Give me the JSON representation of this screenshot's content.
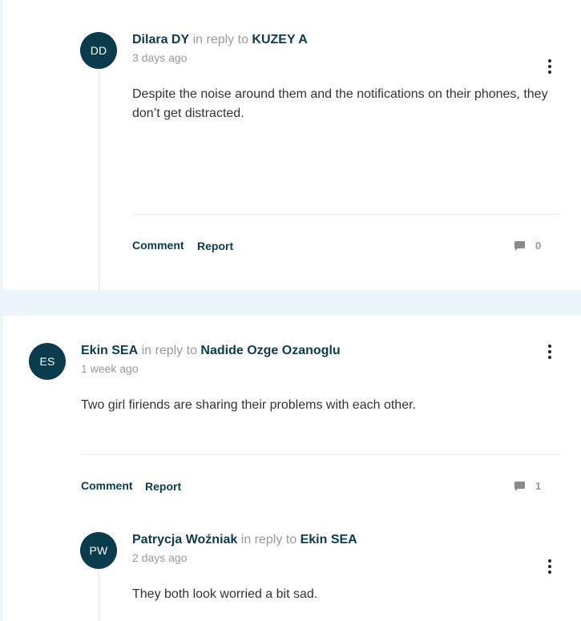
{
  "comments": [
    {
      "initials": "DD",
      "author": "Dilara DY",
      "reply_prefix": "in reply to",
      "reply_to": "KUZEY A",
      "time": "3 days ago",
      "text": "Despite the noise around them and the notifications on their phones, they don’t get distracted.",
      "comment_label": "Comment",
      "report_label": "Report",
      "reply_count": "0"
    },
    {
      "initials": "ES",
      "author": "Ekin SEA",
      "reply_prefix": "in reply to",
      "reply_to": "Nadide Ozge Ozanoglu",
      "time": "1 week ago",
      "text": "Two girl firiends are sharing their problems with each other.",
      "comment_label": "Comment",
      "report_label": "Report",
      "reply_count": "1"
    },
    {
      "initials": "PW",
      "author": "Patrycja Woźniak",
      "reply_prefix": "in reply to",
      "reply_to": "Ekin SEA",
      "time": "2 days ago",
      "text": "They both look worried a bit sad."
    }
  ],
  "icons": {
    "menu": "more-vertical-icon",
    "replies": "comment-bubble-icon"
  },
  "colors": {
    "accent": "#0b3c4d",
    "muted": "#9a9a9a",
    "page_background": "#ecf5f9"
  }
}
